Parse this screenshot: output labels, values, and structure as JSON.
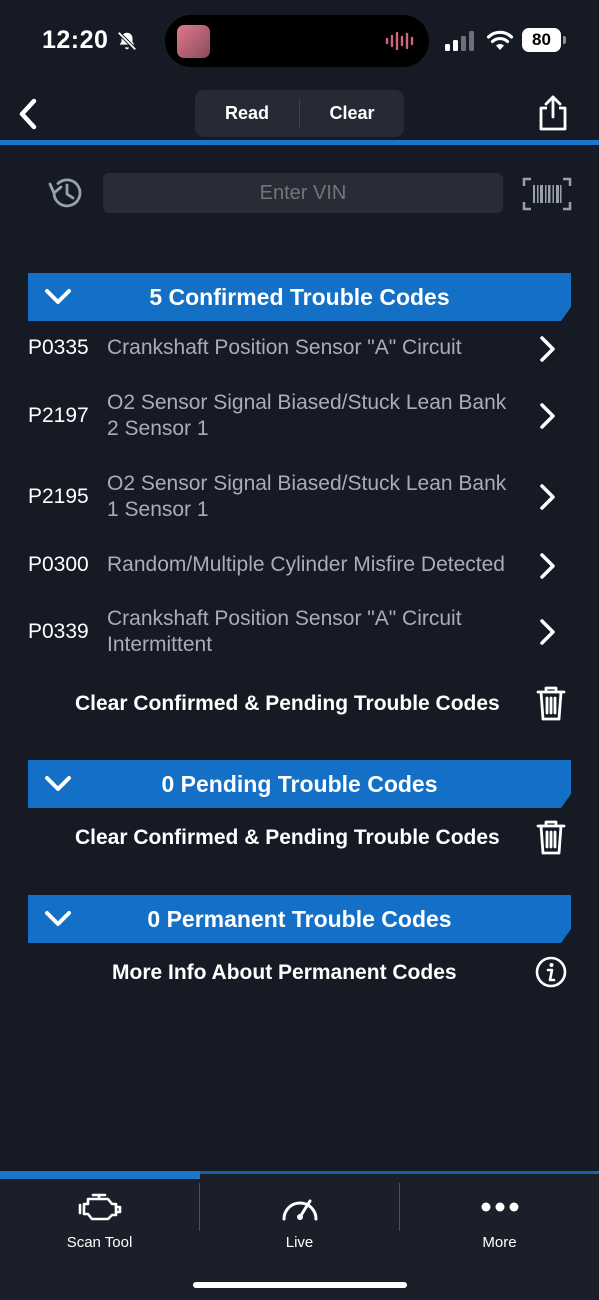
{
  "status_bar": {
    "time": "12:20",
    "battery": "80",
    "icons": [
      "bell-slash-icon",
      "signal-icon",
      "wifi-icon",
      "battery-icon"
    ]
  },
  "nav": {
    "back_icon": "chevron-left-icon",
    "segments": [
      "Read",
      "Clear"
    ],
    "share_icon": "share-icon"
  },
  "vin": {
    "placeholder": "Enter VIN",
    "history_icon": "history-icon",
    "scan_icon": "barcode-icon"
  },
  "confirmed": {
    "title": "5 Confirmed Trouble Codes",
    "codes": [
      {
        "code": "P0335",
        "line1": "Crankshaft Position Sensor \"A\" Circuit",
        "line2": ""
      },
      {
        "code": "P2197",
        "line1": "O2 Sensor Signal Biased/Stuck Lean Bank",
        "line2": "2 Sensor 1"
      },
      {
        "code": "P2195",
        "line1": "O2 Sensor Signal Biased/Stuck Lean Bank",
        "line2": "1 Sensor 1"
      },
      {
        "code": "P0300",
        "line1": "Random/Multiple Cylinder Misfire Detected",
        "line2": ""
      },
      {
        "code": "P0339",
        "line1": "Crankshaft Position Sensor \"A\" Circuit",
        "line2": "Intermittent"
      }
    ],
    "clear_label": "Clear Confirmed & Pending Trouble Codes"
  },
  "pending": {
    "title": "0 Pending Trouble Codes",
    "clear_label": "Clear Confirmed & Pending Trouble Codes"
  },
  "permanent": {
    "title": "0 Permanent Trouble Codes",
    "info_label": "More Info About Permanent Codes"
  },
  "tabs": [
    {
      "label": "Scan Tool",
      "icon": "engine-icon",
      "active": true
    },
    {
      "label": "Live",
      "icon": "gauge-icon",
      "active": false
    },
    {
      "label": "More",
      "icon": "ellipsis-icon",
      "active": false
    }
  ],
  "colors": {
    "background": "#161a24",
    "accent": "#1470c6",
    "secondary_text": "#a8adb7"
  }
}
